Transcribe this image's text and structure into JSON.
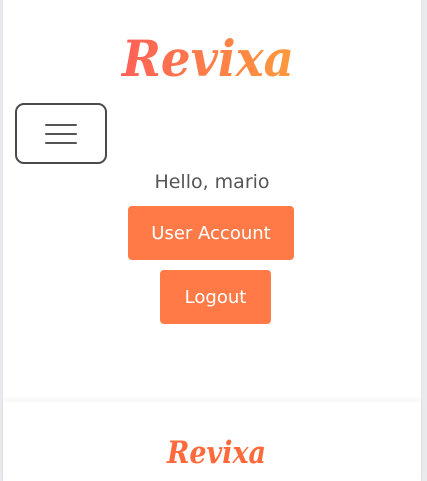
{
  "brand": {
    "name": "Revixa",
    "accent_color": "#ff7a47"
  },
  "nav": {
    "toggler_icon": "hamburger-menu-icon"
  },
  "user_panel": {
    "greeting": "Hello, mario",
    "account_button_label": "User Account",
    "logout_button_label": "Logout"
  },
  "footer": {
    "brand_name": "Revixa"
  }
}
